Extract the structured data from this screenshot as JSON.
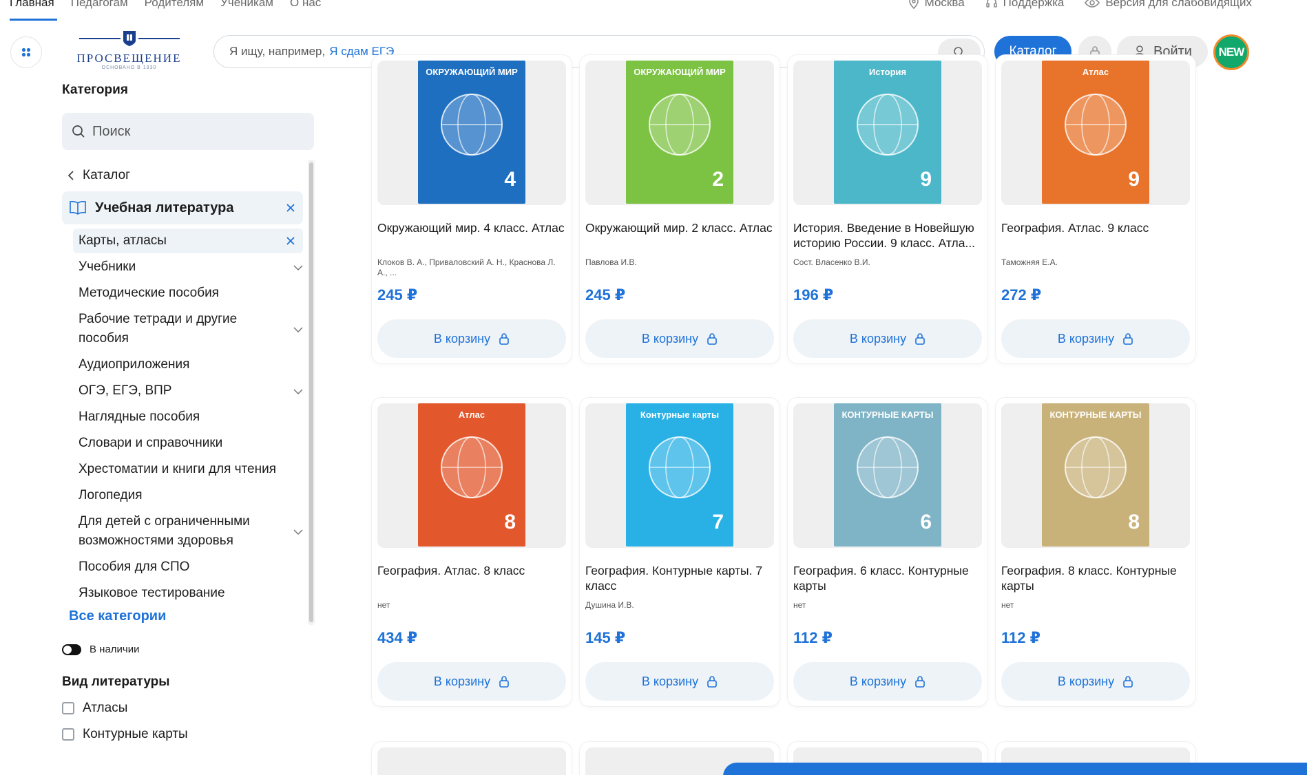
{
  "topnav": {
    "links": [
      "Главная",
      "Педагогам",
      "Родителям",
      "Ученикам",
      "О нас"
    ],
    "city": "Москва",
    "support": "Поддержка",
    "accessibility": "Версия для слабовидящих"
  },
  "header": {
    "logo_text": "ПРОСВЕЩЕНИЕ",
    "logo_sub": "ОСНОВАНО В 1930",
    "search_placeholder": "Я ищу, например,",
    "search_hint": "Я сдам ЕГЭ",
    "catalog_label": "Каталог",
    "login_label": "Войти",
    "new_badge": "NEW"
  },
  "sidebar": {
    "category_heading": "Категория",
    "search_placeholder": "Поиск",
    "breadcrumb": "Каталог",
    "main_category": "Учебная литература",
    "selected_sub": "Карты, атласы",
    "items": [
      {
        "label": "Учебники",
        "expandable": true
      },
      {
        "label": "Методические пособия",
        "expandable": false
      },
      {
        "label": "Рабочие тетради и другие пособия",
        "expandable": true
      },
      {
        "label": "Аудиоприложения",
        "expandable": false
      },
      {
        "label": "ОГЭ, ЕГЭ, ВПР",
        "expandable": true
      },
      {
        "label": "Наглядные пособия",
        "expandable": false
      },
      {
        "label": "Словари и справочники",
        "expandable": false
      },
      {
        "label": "Хрестоматии и книги для чтения",
        "expandable": false
      },
      {
        "label": "Логопедия",
        "expandable": false
      },
      {
        "label": "Для детей с ограниченными возможностями здоровья",
        "expandable": true
      },
      {
        "label": "Пособия для СПО",
        "expandable": false
      },
      {
        "label": "Языковое тестирование",
        "expandable": false
      }
    ],
    "all_categories": "Все категории",
    "in_stock_label": "В наличии",
    "literature_type_heading": "Вид литературы",
    "literature_types": [
      "Атласы",
      "Контурные карты"
    ]
  },
  "products": [
    {
      "title": "Окружающий мир. 4 класс. Атлас",
      "author": "Клоков В. А., Приваловский А. Н., Краснова Л. А., ...",
      "price": "245 ₽",
      "cart": "В корзину",
      "cover": {
        "top": "ОКРУЖАЮЩИЙ МИР",
        "num": "4",
        "color": "#1f6fc0"
      }
    },
    {
      "title": "Окружающий мир. 2 класс. Атлас",
      "author": "Павлова И.В.",
      "price": "245 ₽",
      "cart": "В корзину",
      "cover": {
        "top": "ОКРУЖАЮЩИЙ МИР",
        "num": "2",
        "color": "#7cc243"
      }
    },
    {
      "title": "История. Введение в Новейшую историю России. 9 класс. Атла...",
      "author": "Сост. Власенко В.И.",
      "price": "196 ₽",
      "cart": "В корзину",
      "cover": {
        "top": "История",
        "num": "9",
        "color": "#4bb7c9"
      }
    },
    {
      "title": "География. Атлас. 9 класс",
      "author": "Таможняя Е.А.",
      "price": "272 ₽",
      "cart": "В корзину",
      "cover": {
        "top": "Атлас",
        "num": "9",
        "color": "#e8732a"
      }
    },
    {
      "title": "География. Атлас. 8 класс",
      "author": "нет",
      "price": "434 ₽",
      "cart": "В корзину",
      "cover": {
        "top": "Атлас",
        "num": "8",
        "color": "#e2572b"
      }
    },
    {
      "title": "География. Контурные карты. 7 класс",
      "author": "Душина И.В.",
      "price": "145 ₽",
      "cart": "В корзину",
      "cover": {
        "top": "Контурные карты",
        "num": "7",
        "color": "#29b1e6"
      }
    },
    {
      "title": "География. 6 класс. Контурные карты",
      "author": "нет",
      "price": "112 ₽",
      "cart": "В корзину",
      "cover": {
        "top": "КОНТУРНЫЕ КАРТЫ",
        "num": "6",
        "color": "#7fb3c6"
      }
    },
    {
      "title": "География. 8 класс. Контурные карты",
      "author": "нет",
      "price": "112 ₽",
      "cart": "В корзину",
      "cover": {
        "top": "КОНТУРНЫЕ КАРТЫ",
        "num": "8",
        "color": "#c9b27a"
      }
    }
  ],
  "colors": {
    "accent": "#1e72d8",
    "badge": "#12a86b"
  }
}
